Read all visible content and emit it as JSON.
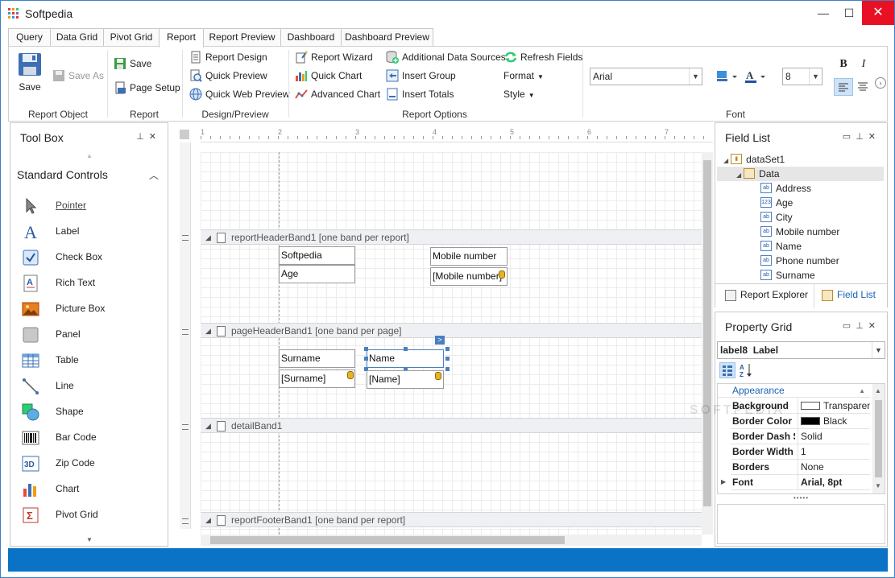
{
  "app": {
    "title": "Softpedia"
  },
  "window_controls": {
    "minimize": "—",
    "maximize": "☐",
    "close": "✕"
  },
  "tabs": [
    {
      "label": "Query"
    },
    {
      "label": "Data Grid"
    },
    {
      "label": "Pivot Grid"
    },
    {
      "label": "Report"
    },
    {
      "label": "Report Preview"
    },
    {
      "label": "Dashboard"
    },
    {
      "label": "Dashboard Preview"
    }
  ],
  "active_tab": "Report",
  "ribbon": {
    "report_object": {
      "save": "Save",
      "save_as": "Save As",
      "label": "Report Object"
    },
    "report": {
      "save": "Save",
      "page_setup": "Page Setup",
      "label": "Report"
    },
    "design_preview": {
      "report_design": "Report Design",
      "quick_preview": "Quick Preview",
      "quick_web_preview": "Quick Web Preview",
      "label": "Design/Preview"
    },
    "report_options": {
      "report_wizard": "Report Wizard",
      "quick_chart": "Quick Chart",
      "advanced_chart": "Advanced Chart",
      "additional_data_sources": "Additional Data Sources",
      "insert_group": "Insert Group",
      "insert_totals": "Insert Totals",
      "refresh_fields": "Refresh Fields",
      "format": "Format",
      "style": "Style",
      "label": "Report Options"
    },
    "font": {
      "family": "Arial",
      "size": "8",
      "bold": "B",
      "italic": "I",
      "label": "Font"
    }
  },
  "toolbox": {
    "title": "Tool Box",
    "section": "Standard Controls",
    "items": [
      {
        "label": "Pointer"
      },
      {
        "label": "Label"
      },
      {
        "label": "Check Box"
      },
      {
        "label": "Rich Text"
      },
      {
        "label": "Picture Box"
      },
      {
        "label": "Panel"
      },
      {
        "label": "Table"
      },
      {
        "label": "Line"
      },
      {
        "label": "Shape"
      },
      {
        "label": "Bar Code"
      },
      {
        "label": "Zip Code"
      },
      {
        "label": "Chart"
      },
      {
        "label": "Pivot Grid"
      }
    ]
  },
  "ruler": {
    "marks": [
      "1",
      "2",
      "3",
      "4",
      "5",
      "6",
      "7"
    ]
  },
  "designer": {
    "bands": [
      {
        "label": "reportHeaderBand1 [one band per report]"
      },
      {
        "label": "pageHeaderBand1 [one band per page]"
      },
      {
        "label": "detailBand1"
      },
      {
        "label": "reportFooterBand1 [one band per report]"
      }
    ],
    "cells": {
      "softpedia": "Softpedia",
      "age": "Age",
      "mobile_label": "Mobile number",
      "mobile_field": "[Mobile number]",
      "surname_label": "Surname",
      "name_label": "Name",
      "surname_field": "[Surname]",
      "name_field": "[Name]"
    }
  },
  "field_list": {
    "title": "Field List",
    "dataset": "dataSet1",
    "table": "Data",
    "fields": [
      {
        "name": "Address",
        "type": "ab"
      },
      {
        "name": "Age",
        "type": "123"
      },
      {
        "name": "City",
        "type": "ab"
      },
      {
        "name": "Mobile number",
        "type": "ab"
      },
      {
        "name": "Name",
        "type": "ab"
      },
      {
        "name": "Phone number",
        "type": "ab"
      },
      {
        "name": "Surname",
        "type": "ab"
      }
    ],
    "tabs": {
      "report_explorer": "Report Explorer",
      "field_list": "Field List"
    }
  },
  "property_grid": {
    "title": "Property Grid",
    "selected_object": "label8",
    "selected_type": "Label",
    "category": "Appearance",
    "rows": [
      {
        "name": "Background",
        "value": "Transparent",
        "swatch": "#ffffff"
      },
      {
        "name": "Border Color",
        "value": "Black",
        "swatch": "#000000"
      },
      {
        "name": "Border Dash Style",
        "value": "Solid"
      },
      {
        "name": "Border Width",
        "value": "1"
      },
      {
        "name": "Borders",
        "value": "None"
      },
      {
        "name": "Font",
        "value": "Arial, 8pt"
      }
    ],
    "splitter": "•••••"
  },
  "watermark": "SOFTPEDIA",
  "colors": {
    "accent": "#0a73c6",
    "close": "#e81123",
    "selection": "#cfe3f7"
  }
}
